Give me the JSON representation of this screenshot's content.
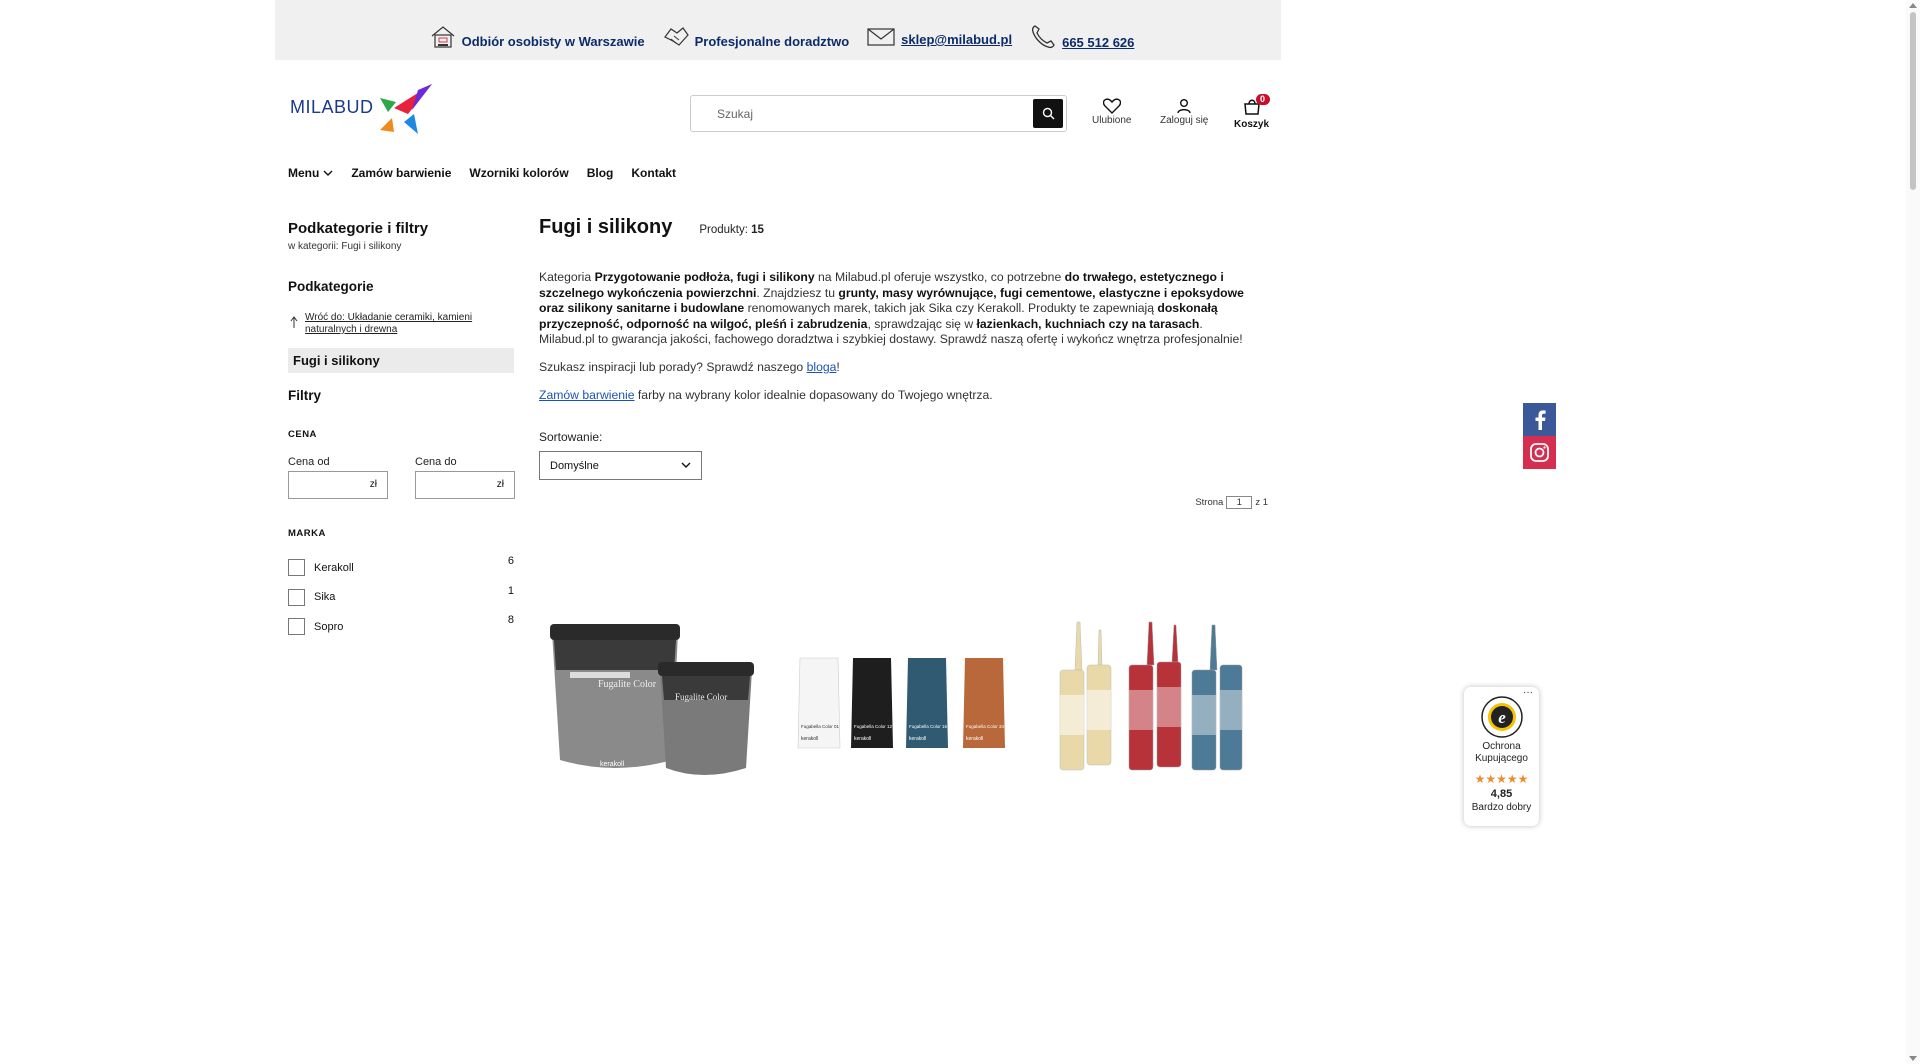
{
  "topbar": {
    "pickup": "Odbiór osobisty w Warszawie",
    "advice": "Profesjonalne doradztwo",
    "email": "sklep@milabud.pl",
    "phone": "665 512 626"
  },
  "header": {
    "logo_text": "MILABUD",
    "search_placeholder": "Szukaj",
    "favorites_label": "Ulubione",
    "login_label": "Zaloguj się",
    "cart_label": "Koszyk",
    "cart_count": "0"
  },
  "nav": {
    "items": [
      "Menu",
      "Zamów barwienie",
      "Wzorniki kolorów",
      "Blog",
      "Kontakt"
    ]
  },
  "sidebar": {
    "title": "Podkategorie i filtry",
    "subtitle": "w kategorii: Fugi i silikony",
    "subcategories_heading": "Podkategorie",
    "back_link": "Wróć do: Układanie ceramiki, kamieni naturalnych i drewna",
    "active_category": "Fugi i silikony",
    "filters_heading": "Filtry",
    "price_heading": "CENA",
    "price_from_label": "Cena od",
    "price_to_label": "Cena do",
    "currency": "zł",
    "brand_heading": "MARKA",
    "brands": [
      {
        "name": "Kerakoll",
        "count": "6"
      },
      {
        "name": "Sika",
        "count": "1"
      },
      {
        "name": "Sopro",
        "count": "8"
      }
    ]
  },
  "content": {
    "title": "Fugi i silikony",
    "products_label": "Produkty:",
    "products_count": "15",
    "desc": {
      "p1_a": "Kategoria ",
      "p1_b": "Przygotowanie podłoża, fugi i silikony",
      "p1_c": " na Milabud.pl oferuje wszystko, co potrzebne ",
      "p1_d": "do trwałego, estetycznego i szczelnego wykończenia powierzchni",
      "p1_e": ". Znajdziesz tu ",
      "p1_f": "grunty, masy wyrównujące, fugi cementowe, elastyczne i epoksydowe oraz silikony sanitarne i budowlane",
      "p1_g": " renomowanych marek, takich jak Sika czy Kerakoll. Produkty te zapewniają ",
      "p1_h": "doskonałą przyczepność, odporność na wilgoć, pleśń i zabrudzenia",
      "p1_i": ", sprawdzając się w ",
      "p1_j": "łazienkach, kuchniach czy na tarasach",
      "p1_k": ". Milabud.pl to gwarancja jakości, fachowego doradztwa i szybkiej dostawy. Sprawdź naszą ofertę i wykończ wnętrza profesjonalnie!",
      "p2_a": "Szukasz inspiracji lub porady? Sprawdź naszego ",
      "p2_link": "bloga",
      "p2_b": "!",
      "p3_link": "Zamów barwienie",
      "p3_a": " farby na wybrany kolor idealnie dopasowany do Twojego wnętrza."
    },
    "sort_label": "Sortowanie:",
    "sort_value": "Domyślne",
    "pager": {
      "label": "Strona",
      "page": "1",
      "of": "z 1"
    }
  },
  "products": [
    {
      "icon": "fugalite-color-buckets",
      "labels": [
        "Fugalite Color",
        "Fugalite Color"
      ],
      "brand": "kerakoll"
    },
    {
      "icon": "fugabella-color-bags",
      "labels": [
        "Fugabella Color 01",
        "Fugabella Color 12",
        "Fugabella Color 16",
        "Fugabella Color 34"
      ],
      "brand": "kerakoll"
    },
    {
      "icon": "silicone-cartridges"
    }
  ],
  "trust": {
    "title": "Ochrona Kupującego",
    "stars": "★★★★★",
    "score": "4,85",
    "rating_label": "Bardzo dobry",
    "menu_dots": "···"
  },
  "colors": {
    "navy": "#0d2b6b",
    "link_blue": "#1a53b8",
    "cart_badge": "#c8102e",
    "facebook": "#3b5998",
    "instagram": "#d62e50",
    "stars": "#e98e2f"
  }
}
